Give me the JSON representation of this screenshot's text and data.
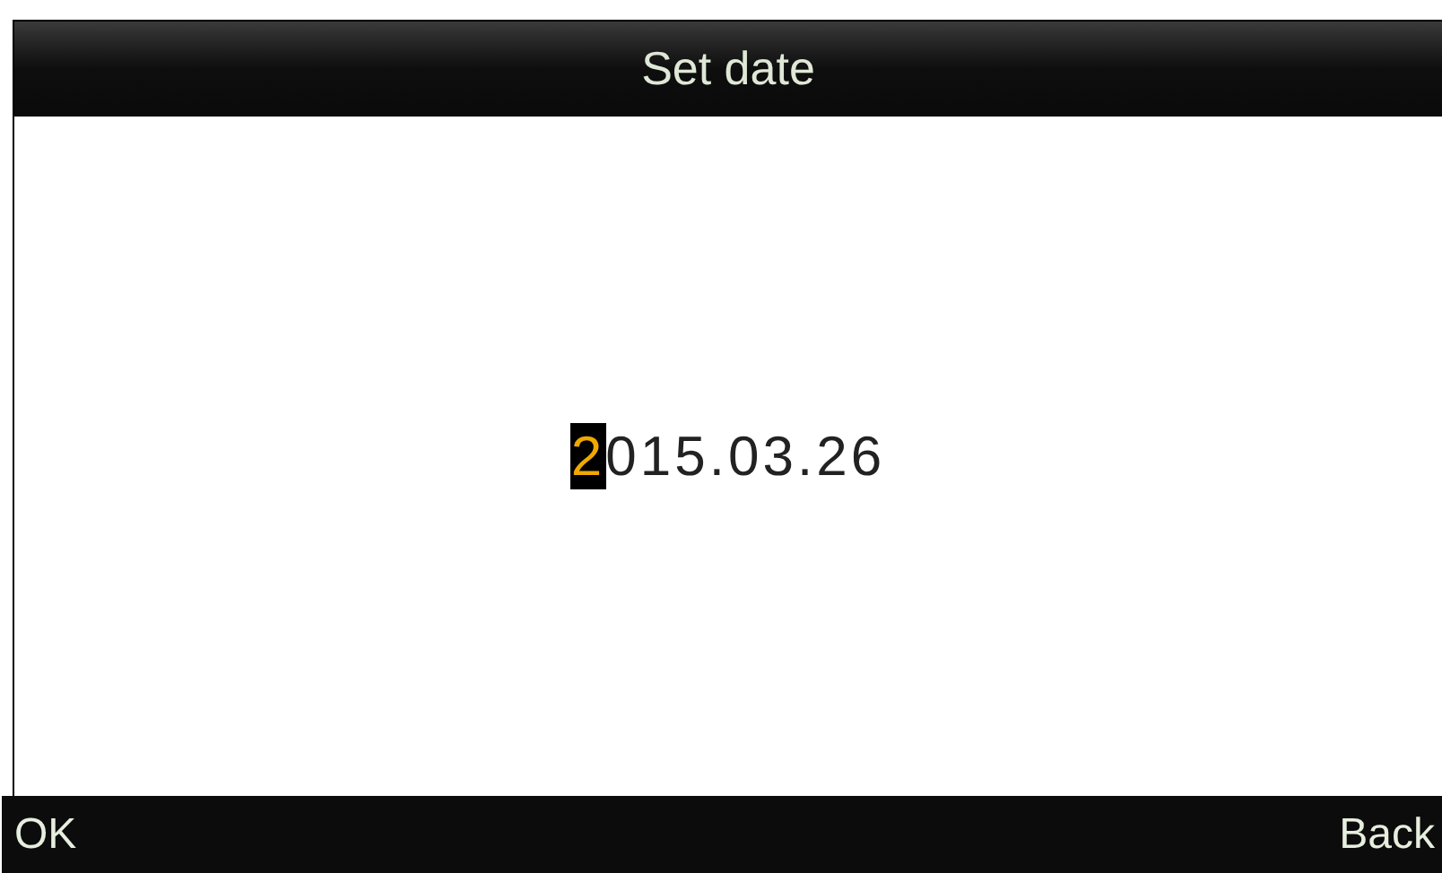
{
  "title_bar": {
    "title": "Set date"
  },
  "date_field": {
    "segments": [
      {
        "text": "2",
        "selected": true
      },
      {
        "text": "015.03.26",
        "selected": false
      }
    ]
  },
  "softkeys": [
    {
      "label": "OK"
    },
    {
      "label": "Back"
    }
  ]
}
